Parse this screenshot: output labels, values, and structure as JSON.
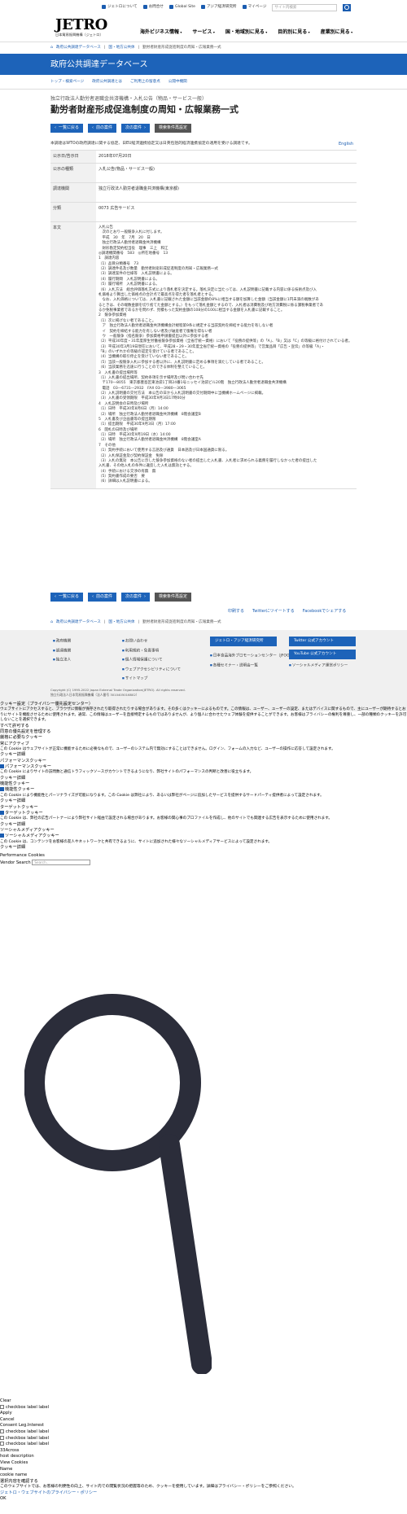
{
  "topbar": {
    "links": [
      "ジェトロについて",
      "お問合せ",
      "Global Site",
      "アジア経済研究所",
      "マイページ"
    ],
    "search_placeholder": "サイト内検索"
  },
  "logo": {
    "main": "JETRO",
    "sub": "日本貿易振興機構（ジェトロ）"
  },
  "global_nav": [
    "海外ビジネス情報",
    "サービス",
    "国・地域別に見る",
    "目的別に見る",
    "産業別に見る"
  ],
  "breadcrumb": [
    "ホーム",
    "政府公共調達データベース",
    "国・地方公共体",
    "勤労者財産形成促進制度の周知・広報業務一式"
  ],
  "banner_title": "政府公共調達データベース",
  "subnav": [
    "トップ・検索ページ",
    "政府公共調達とは",
    "ご利用上の留意点",
    "公開中機関"
  ],
  "category": "独立行政法人勤労者退職金共済機構・入札公告（物品・サービス一般）",
  "title": "勤労者財産形成促進制度の周知・広報業務一式",
  "buttons": {
    "back": "一覧に戻る",
    "prev": "前の案件",
    "next": "次の案件",
    "newsearch": "検索条件再設定"
  },
  "intro": "本調達はWTOの政府調達に関する協定、日EU経済連携協定又は日英包括的経済連携協定の適用を受ける調達です。",
  "english_link": "English",
  "info_rows": [
    {
      "k": "公示日/告示日",
      "v": "2018年07月20日"
    },
    {
      "k": "公示の種類",
      "v": "入札公告(物品・サービス一般)"
    },
    {
      "k": "調達機関",
      "v": "独立行政法人勤労者退職金共済機構(東京都)"
    },
    {
      "k": "分類",
      "v": "0073 広告サービス"
    }
  ],
  "body_label": "本文",
  "body_lines": [
    "入札公告",
    "　次のとおり一般競争入札に付します。",
    "　平成　30　年　7月　20　日",
    "　独立行政法人勤労者退職金共済機構",
    "　財形勘定契約担当役　理事　三上　和江",
    "◎調達機関番号　583　◎所在地番号　13",
    "1　調達内容",
    "（1）品目分類番号　73",
    "（2）調達件名及び数量　勤労者財産形成促進制度の周知・広報業務一式",
    "（3）調達案件の仕様等　入札説明書による。",
    "（4）履行期間　入札説明書による。",
    "（5）履行場所　入札説明書による。",
    "（6）入札方法　総合評価落札方式により落札者を決定する。落札決定に当たっては、入札説明書に記載する内容に係る技術点及び入",
    "札価格より算出した価格点の合計点で最高点を得た者を落札者とする。",
    "　なお、入札価格については、入札書に記載された金額に当該金額の8%に相当する額を加算した金額（当該金額に1円未満の端数があ",
    "るときは、その端数金額を切り捨てた金額とする。）をもって落札金額とするので、入札者は消費税及び地方消費税に係る課税事業者であ",
    "るか免税事業者であるかを問わず、見積もった契約金額の108分の100に相当する金額を入札書に記載すること。",
    "2　競争参加資格",
    "（1）次に掲げない者であること。",
    "　ア　独立行政法人勤労者退職金共済機構会計規程第9条に規定する当該契約を締結する能力を有しない者",
    "　イ　契約を締結する能力を有しない者及び破産者で復権を得ない者",
    "　ウ　一般競争（指名競争）参加資格申請書提出以外に参加する者",
    "（2）平成30年度・31年度厚生労働省競争参加資格（全省庁統一資格）において「役務の提供等」の「A」、「B」又は「C」の等級に格付けされている者。",
    "（3）平成30年3月19日現在において、平成28・29・30年度全省庁統一資格の「役務の提供等」で営業品目「広告・宣伝」の等級「A」・",
    "「B」のいずれかの等級の認定を受けている者であること。",
    "（4）当機構の取引停止を受けていない者であること。",
    "（5）当該一般競争入札に参加する者以外に、入札説明書に定める事項を満たしている者であること。",
    "（6）当該業務を迅速に行うことのできる体制を整えていること。",
    "3　入札書の提出場所等",
    "（1）入札書の提出場所、契約条項を示す場所及び問い合わせ先",
    "　〒170―8055　東京都豊島区東池袋1丁目24番1号ニッセイ池袋ビル20階　独立行政法人勤労者退職金共済機構",
    "　電話　03―6731―2932　FAX 03―3980―3065",
    "（2）入札説明書の交付方法　本公告の日から入札説明書の交付期間中に当機構ホームページに掲載。",
    "（3）入札書の受領期限　平成30年9月3日17時00分",
    "4　入札説明会の日時及び場所",
    "（1）日時　平成30年8月6日（月）14:00",
    "（2）場所　独立行政法人勤労者退職金共済機構　8階会議室B",
    "5　入札書及び企画書等の提出期限",
    "（1）提出期限　平成30年9月3日（月）17:00",
    "6　開札の日時及び場所",
    "（1）日時　平成30年9月19日（水）14:00",
    "（2）場所　独立行政法人勤労者退職金共済機構　8階会議室A",
    "7　その他",
    "（1）契約手続において使用する言語及び通貨　日本語及び日本国通貨に限る。",
    "（2）入札保証金及び契約保証金　免除",
    "（3）入札の無効　本公告に示した競争参加資格のない者の提出した入札書、入札者に求められる義務を履行しなかった者の提出した",
    "入札書、その他入札の条件に違反した入札は無効とする。",
    "（4）手続における交渉の有無　無",
    "（5）契約書作成の要否　要",
    "（6）詳細は入札説明書による。"
  ],
  "social": [
    "印刷する",
    "Twitterにツイートする",
    "Facebookでシェアする"
  ],
  "footer": {
    "col1": [
      "政府機関",
      "調達機関",
      "独立法人"
    ],
    "col2": [
      "お問い合わせ",
      "利用規約・免責事項",
      "個人情報保護について",
      "ウェブアクセシビリティについて",
      "サイトマップ"
    ],
    "col3_btn": "ジェトロ・アジア経済研究所",
    "col3_links": [
      "日本食品海外プロモーションセンター（JFOODO）",
      "各種セミナー・説明会一覧"
    ],
    "sns": [
      "Twitter 公式アカウント",
      "YouTube 公式アカウント"
    ],
    "col4_link": "ソーシャルメディア運営ポリシー",
    "copyright": "Copyright (C) 1995-2022 Japan External Trade Organization(JETRO). All rights reserved.",
    "org": "独立行政法人日本貿易振興機構（法人番号 3010405016802）"
  },
  "cookie": {
    "title": "クッキー設定（プライバシー優先設定センター）",
    "desc": "ウェブサイトにアクセスすると、ブラウザに情報が保存されたり取得されたりする場合があります。その多くはクッキーによるものです。この情報は、ユーザー、ユーザーの設定、またはデバイスに関するもので、主にユーザーが期待するとおりにサイトを機能させるために使用されます。通常、この情報はユーザーを直接特定するものではありませんが、より個人に合わせたウェブ体験を提供することができます。お客様はプライバシーの権利を尊重し、一部の種類のクッキーを許可しないことを選択できます。",
    "allow_all": "すべて許可する",
    "manage": "同意の優先設定を管理する",
    "strict": "厳格に必要なクッキー",
    "always": "常にアクティブ",
    "strict_desc": "この Cookie はウェブサイトが正常に機能するために必要なもので、ユーザーのシステム内で無効にすることはできません。ログイン、フォームの入力など、ユーザーの操作に応答して設定されます。",
    "details": "クッキー詳細",
    "perf": "パフォーマンスクッキー",
    "perf_desc": "この Cookie によりサイトの訪問数と通信トラフィックソースがカウントできるようになり、弊社サイトのパフォーマンスの判断と改善に役立ちます。",
    "func": "機能性クッキー",
    "func_desc": "この Cookie により機能性とパーソナライズが可能になります。この Cookie は弊社により、あるいは弊社がページに追加したサービスを提供するサードパーティ提供者によって設定されます。",
    "target": "ターゲットクッキー",
    "target_desc": "この Cookie は、弊社の広告パートナーにより弊社サイト経由で設定される場合があります。お客様の関心事のプロファイルを作成し、他のサイトでも関連する広告を表示するために使用されます。",
    "social": "ソーシャルメディアクッキー",
    "social_desc": "この Cookie は、コンテンツをお客様の友人やネットワークと共有できるように、サイトに追加された様々なソーシャルメディアサービスによって設定されます。",
    "perf_cookies": "Performance Cookies",
    "vendor": "Vendor Search",
    "vendor_ph": "Search..."
  },
  "bottom": {
    "items": [
      "Clear",
      "checkbox label label",
      "Apply",
      "Cancel",
      "Consent Leg.Interest",
      "checkbox label label",
      "checkbox label label",
      "checkbox label label",
      "33Across",
      "host description",
      "View Cookies",
      "Name",
      "cookie name"
    ],
    "save": "選択内容を確認する",
    "jetro_policy": "このウェブサイトでは、お客様の利便性の向上、サイト内での閲覧状況の把握等のため、クッキーを使用しています。詳細はプライバシー・ポリシーをご参照ください。",
    "privacy_link": "ジェトロ・ウェブサイトのプライバシー・ポリシー",
    "ok": "OK"
  },
  "colors": {
    "brand": "#1d63b9",
    "gray_btn": "#555555",
    "icon": "#2b2d3a"
  }
}
